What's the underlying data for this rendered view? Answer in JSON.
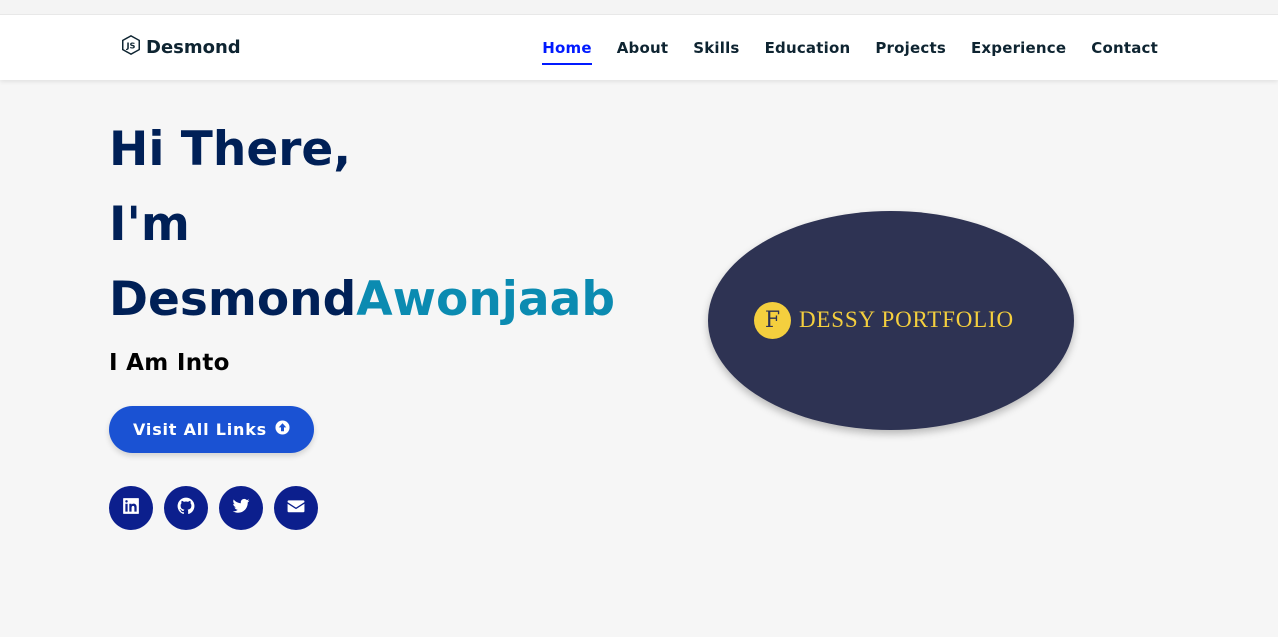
{
  "brand": {
    "name": "Desmond",
    "icon": "node-js-icon"
  },
  "nav": {
    "items": [
      {
        "label": "Home",
        "active": true
      },
      {
        "label": "About"
      },
      {
        "label": "Skills"
      },
      {
        "label": "Education"
      },
      {
        "label": "Projects"
      },
      {
        "label": "Experience"
      },
      {
        "label": "Contact"
      }
    ],
    "active_color": "#011aff"
  },
  "hero": {
    "line1": "Hi There,",
    "line2": "I'm",
    "first_name": "Desmond",
    "last_name": "Awonjaab",
    "subtitle": "I Am Into",
    "cta_label": "Visit All Links",
    "cta_icon": "arrow-circle-up-icon"
  },
  "socials": [
    {
      "icon": "linkedin-icon"
    },
    {
      "icon": "github-icon"
    },
    {
      "icon": "twitter-icon"
    },
    {
      "icon": "envelope-icon"
    }
  ],
  "logo": {
    "mark": "F",
    "text": "DESSY PORTFOLIO"
  },
  "colors": {
    "heading": "#002057",
    "accent": "#0b8bb1",
    "button": "#1a52d3",
    "social_bg": "#0c1f8d",
    "logo_bg": "#2e3353",
    "logo_gold": "#f4cf3e"
  }
}
